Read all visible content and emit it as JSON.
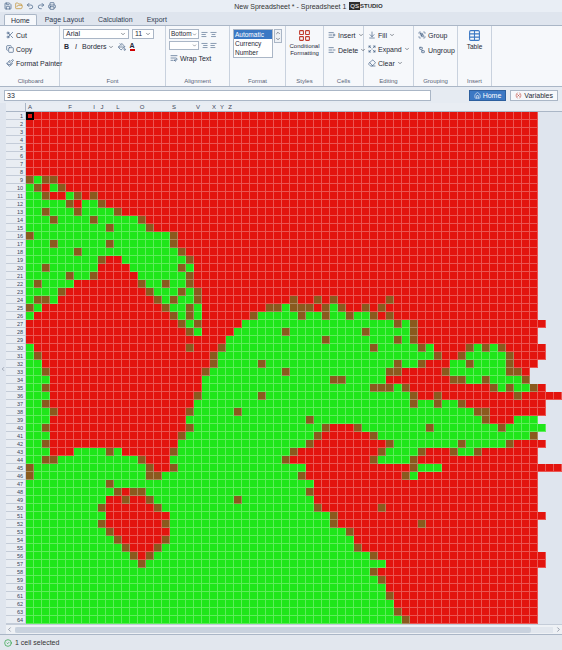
{
  "window": {
    "title": "New Spreadsheet * - Spreadsheet 1",
    "logo": {
      "mark": "QS",
      "text": "STUDIO"
    }
  },
  "tabs": [
    {
      "label": "Home",
      "selected": true
    },
    {
      "label": "Page Layout",
      "selected": false
    },
    {
      "label": "Calculation",
      "selected": false
    },
    {
      "label": "Export",
      "selected": false
    }
  ],
  "ribbon": {
    "clipboard": {
      "label": "Clipboard",
      "cut": "Cut",
      "copy": "Copy",
      "format_painter": "Format Painter"
    },
    "font": {
      "label": "Font",
      "family": "Arial",
      "size": "11",
      "bold": "B",
      "italic": "I",
      "borders": "Borders",
      "color_letter": "A"
    },
    "alignment": {
      "label": "Alignment",
      "vertical": "Bottom",
      "wrap": "Wrap Text"
    },
    "format": {
      "label": "Format",
      "options": [
        {
          "label": "Automatic",
          "selected": true
        },
        {
          "label": "Currency",
          "selected": false
        },
        {
          "label": "Number",
          "selected": false
        }
      ]
    },
    "styles": {
      "label": "Styles",
      "button": "Conditional Formatting"
    },
    "cells": {
      "label": "Cells",
      "buttons": [
        "Insert",
        "Delete"
      ]
    },
    "editing": {
      "label": "Editing",
      "buttons": [
        "Fill",
        "Expand",
        "Clear"
      ]
    },
    "grouping": {
      "label": "Grouping",
      "buttons": [
        "Group",
        "Ungroup"
      ]
    },
    "insert": {
      "label": "Insert",
      "button": "Table"
    }
  },
  "formula_bar": {
    "name_box": "33",
    "views": [
      {
        "label": "Home",
        "selected": true
      },
      {
        "label": "Variables",
        "selected": false
      }
    ]
  },
  "sheet": {
    "palette": {
      "r": "#e3140e",
      "g": "#1fe61a",
      "d": "#8a5a1e"
    },
    "selection": {
      "row": "1",
      "column": "A"
    },
    "column_labels": [
      "A",
      "",
      "",
      "",
      "",
      "F",
      "",
      "",
      "I",
      "J",
      "",
      "L",
      "",
      "",
      "O",
      "",
      "",
      "",
      "S",
      "",
      "",
      "V",
      "",
      "X",
      "Y",
      "Z",
      "",
      "",
      "",
      "",
      "",
      "",
      "",
      "",
      "",
      "",
      "",
      "",
      "",
      "",
      "",
      "",
      "",
      "",
      "",
      "",
      "",
      "",
      "",
      "",
      "",
      "",
      "",
      "",
      "",
      "",
      "",
      "",
      "",
      "",
      "",
      "",
      "",
      ""
    ],
    "rows": [
      {
        "label": "1",
        "cells": "rrrrrrrrrrrrrrrrrrrrrrrrrrrrrrrrrrrrrrrrrrrrrrrrrrrrrrrrrrrrrrrr"
      },
      {
        "label": "2",
        "cells": "rrrrrrrrrrrrrrrrrrrrrrrrrrrrrrrrrrrrrrrrrrrrrrrrrrrrrrrrrrrrrrrr"
      },
      {
        "label": "3",
        "cells": "rrrrrrrrrrrrrrrrrrrrrrrrrrrrrrrrrrrrrrrrrrrrrrrrrrrrrrrrrrrrrrrr"
      },
      {
        "label": "4",
        "cells": "rrrrrrrrrrrrrrrrrrrrrrrrrrrrrrrrrrrrrrrrrrrrrrrrrrrrrrrrrrrrrrrr"
      },
      {
        "label": "5",
        "cells": "rrrrrrrrrrrrrrrrrrrrrrrrrrrrrrrrrrrrrrrrrrrrrrrrrrrrrrrrrrrrrrrr"
      },
      {
        "label": "6",
        "cells": "rrrrrrrrrrrrrrrrrrrrrrrrrrrrrrrrrrrrrrrrrrrrrrrrrrrrrrrrrrrrrrrr"
      },
      {
        "label": "7",
        "cells": "rrrrrrrrrrrrrrrrrrrrrrrrrrrrrrrrrrrrrrrrrrrrrrrrrrrrrrrrrrrrrrrr"
      },
      {
        "label": "8",
        "cells": "rrrrrrrrrrrrrrrrrrrrrrrrrrrrrrrrrrrrrrrrrrrrrrrrrrrrrrrrrrrrrrrr"
      },
      {
        "label": "9",
        "cells": "dgddrrrrrrrrrrrrrrrrrrrrrrrrrrrrrrrrrrrrrrrrrrrrrrrrrrrrrrrrrrrr"
      },
      {
        "label": "10",
        "cells": "gdrgdrrrrrrrrrrrrrrrrrrrrrrrrrrrrrrrrrrrrrrrrrrrrrrrrrrrrrrrrrrr"
      },
      {
        "label": "11",
        "cells": "ggdrrgdrdrrrrrrrrrrrrrrrrrrrrrrrrrrrrrrrrrrrrrrrrrrrrrrrrrrrrrrr"
      },
      {
        "label": "12",
        "cells": "gggggdrggdrrrrrrrrrrrrrrrrrrrrrrrrrrrrrrrrrrrrrrrrrrrrrrrrrrrrrr"
      },
      {
        "label": "13",
        "cells": "ggdgggdggggdrrrrrrrrrrrrrrrrrrrrrrrrrrrrrrrrrrrrrrrrrrrrrrrrrrrr"
      },
      {
        "label": "14",
        "cells": "gggdggggdgggggdrrrrrrrrrrrrrrrrrrrrrrrrrrrrrrrrrrrrrrrrrrrrrrrrr"
      },
      {
        "label": "15",
        "cells": "ggggggggggdggggdrrrrrrrrrrrrrrrrrrrrrrrrrrrrrrrrrrrrrrrrrrrrrrrr"
      },
      {
        "label": "16",
        "cells": "dgggggggggggggggggdrrrrrrrrrrrrrrrrrrrrrrrrrrrrrrrrrrrrrrrrrrrrr"
      },
      {
        "label": "17",
        "cells": "gggdggggggdgggggggdrrrrrrrrrrrrrrrrrrrrrrrrrrrrrrrrrrrrrrrrrrrrr"
      },
      {
        "label": "18",
        "cells": "ggggggdggggggggggggdrrrrrrrrrrrrrrrrrrrrrrrrrrrrrrrrrrrrrrrrrrrr"
      },
      {
        "label": "19",
        "cells": "gggggggggdrrggggggggdrrrrrrrrrrrrrrrrrrrrrrrrrrrrrrrrrrrrrrrrrrr"
      },
      {
        "label": "20",
        "cells": "ggdggggggrrrrggggggdgrrrrrrrrrrrrrrrrrrrrrrrrrrrrrrrrrrrrrrrrrrr"
      },
      {
        "label": "21",
        "cells": "gggggdggdrrrrrggggggdrrrrrrrrrrrrrrrrrrrrrrrrrrrrrrrrrrrrrrrrrrr"
      },
      {
        "label": "22",
        "cells": "gdggggrrrrrrrrdggdggdrrrrrrrrrrrrrrrrrrrrrrrrrrrrrrrrrrrrrrrrrrr"
      },
      {
        "label": "23",
        "cells": "ggggdrrrrrrrrrrdgggdgdrrrrrrrrrrrrrrrrrrrrrrrrrrrrrrrrrrrrrrrrrr"
      },
      {
        "label": "24",
        "cells": "gddgrrrrrrrrrrrrdgdggdrrrrrrrrrrrdrrdrdrrrrrrdrrrrrrrrrrrrrrrrrr"
      },
      {
        "label": "25",
        "cells": "dgrrrrrrrrrrrrrrrdggdgrrrrrrrrddgdddrdgdrrdrdrrrrrrrrrrrrrrrrrrr"
      },
      {
        "label": "26",
        "cells": "grrrrrrrrrrrrrrrrrdgdgrrrrrrdgggggdggdggdggdrdrrrrrrrrrrrrrrrrrr"
      },
      {
        "label": "27",
        "cells": "rrrrrrrrrrrrrrrrrrrdgdrrrrrgggggggggggggggggggdgdrrrrrrrrrrrrrrrr"
      },
      {
        "label": "28",
        "cells": "rrrrrrrrrrrrrrrrrrrrdgrrrrggggggdgggggggggdgggggdrrrrrrrrrrrrrrr"
      },
      {
        "label": "29",
        "cells": "rrrrrrrrrrrrrrrrrrrrrrrrrggggggggggggdggggggggdgdrrrrrrrrrrrrrrr"
      },
      {
        "label": "30",
        "cells": "grrrrrrrrrrrrrrrrrrrdrrrdggggggggggggggggggdgggggdgrrrrdgdgdrrrrr"
      },
      {
        "label": "31",
        "cells": "gdrrrrrrrrrrrrrrrrrrrrrdgggggggggggggggggggggggggggdrrdgggggdrrrr"
      },
      {
        "label": "32",
        "cells": "ggrrrrrrrrrrrrrrrrrrrrrdgggggdggggggggggggggggdggdrrrggdggggdrrr"
      },
      {
        "label": "33",
        "cells": "ggdrrrrrrrrrrrrrrrrrrrdgggggggggdggggggggggggddrrrrrdgggggggddr"
      },
      {
        "label": "34",
        "cells": "gggrrrrrrrrrrrrrrrrrrrggggggggggggggggddgggggrrrrrrrrddggdggggd"
      },
      {
        "label": "35",
        "cells": "ggdrrrrrrrrrrrrrrrrrrrgggggggggggggggggggggdddgdrrrrrrrrrrdgdggdr"
      },
      {
        "label": "36",
        "cells": "gggrrrrrrrrrrrrrrrrrrdgggggggdggggggggggggggggggdrrdrrrrrrrrrdrrrrr"
      },
      {
        "label": "37",
        "cells": "ggdrrrrrrrrrrrrrrrrrrgggggggggggggggggggggggggggdggdggdrrrrrrrrrr"
      },
      {
        "label": "38",
        "cells": "gggdrrrrrrrrrrrrrrrrdgggggdgggggggggggggggggggggggggggggddrrrrrrr"
      },
      {
        "label": "39",
        "cells": "gggrrrrrrrrrrrrrrrrrgggggggggggggggdgggggggggggggggggggggdrrrggg"
      },
      {
        "label": "40",
        "cells": "ggdrrrrrrrrrrrrrrrrrdggggggggggggggggdrrrdggggggggdggggggggdggggg"
      },
      {
        "label": "41",
        "cells": "gggrrrrrrrrrrrrrrrrdggggggggggggggggdrrrrrrdgggggggggggggggggggd"
      },
      {
        "label": "42",
        "cells": "ggdrrrrrrrrrrrrrrrrggggggggggggggggdrrrrrrrrrdggggggggdgggggdrrrr"
      },
      {
        "label": "43",
        "cells": "gggrrrggggdgrrrrrrdggggggggggggggdrrrrrrrrrrdggggdrrrdggdrrrrrrr"
      },
      {
        "label": "44",
        "cells": "ggddggggggggggdrrrggggggggggggggdrrrrrrrrrrdggggdrrrrrrrrrrrrrrr"
      },
      {
        "label": "45",
        "cells": "dggggggggggggggdrrdggggggggggggggggrrrrrrrrrrrrrdgggrrrrrrrrrrrrrrr"
      },
      {
        "label": "46",
        "cells": "dggggggggggggggddgggggggggggggggggdrrrrrrrrrrrrdgrrrrrrrrrrrrrrr"
      },
      {
        "label": "47",
        "cells": "ggggggggggdgggggggggggggggggggggggggrrrrrrrrrrrrrrrrrrrrrrrrrrrr"
      },
      {
        "label": "48",
        "cells": "gggggggggggdrddggggggggggggggggggggdrrrrrrrrrrrrrrrrrrrrrrrrrrrr"
      },
      {
        "label": "49",
        "cells": "ggggggggggrrdrrdggggggggggdgggggggggrrrrrrrrrrrrrrrrrrrrrrrrrrrr"
      },
      {
        "label": "50",
        "cells": "gggggggggdrrrrrrdgggggggggggggggggggdrrrrrrrdrrrrrrrrrrrrrrrrrrr"
      },
      {
        "label": "51",
        "cells": "ggggggggggrrrrrrrrggggggggggggggggggggdrrrrrrrrrrrrrrrrrrrrrrrrrr"
      },
      {
        "label": "52",
        "cells": "gggggggggdrrrrrrrdggggggggggggggggggggdrrrrrrrrrrdrrrrrrrrrrrrrr"
      },
      {
        "label": "53",
        "cells": "ggggggggggdrrrrrrrggggggggggggggggggggggdrrrrrrrrrrrrrrrrrrrrrrr"
      },
      {
        "label": "54",
        "cells": "gggggggggggdrrrrrdgggggggggggggggggggggggrrrrrrrrrrrrrrrrrrrrrrr"
      },
      {
        "label": "55",
        "cells": "ggggggggggggdrrrdggggggggggggggggggggggggdrrrrrrrrrrrrrrrrrrrrrr"
      },
      {
        "label": "56",
        "cells": "gggggggggggggdrdgggggggggggggggggggggggggggdrrrrrrrrrrrrrrrrrrrrr"
      },
      {
        "label": "57",
        "cells": "ggggggggggggggdggggggggggggggggggggggggggggggrrrrrrrrrrrrrrrrrrrr"
      },
      {
        "label": "58",
        "cells": "gggggggggggggggggggggggggggggggggggggggggggdrrrrrrrrrrrrrrrrrrrr"
      },
      {
        "label": "59",
        "cells": "ggggggggggggggggggggggggggggggggggggggggggggdrrrrrrrrrrrrrrrrrrr"
      },
      {
        "label": "60",
        "cells": "gggggggggggggggggggggggggggggggggggggggggggggrrrrrrrrrrrrrrrrrrr"
      },
      {
        "label": "61",
        "cells": "gggggggggggggggggggggggggggggggggggggggggggggdrrrrrrrrrrrrrrrrrr"
      },
      {
        "label": "62",
        "cells": "ggggggggggggggggggggggggggggggggggggggggggggggrrrrrrrrrrrrrrrrrr"
      },
      {
        "label": "63",
        "cells": "ggggggggggggggggggggggggggggggggggggggggggggggdrrrrrrrrrrrrrrrrr"
      },
      {
        "label": "64",
        "cells": "gggggggggggggggggggggggggggggggggggggggggggggggdrrrrrrrrrrrrrrrr"
      }
    ]
  },
  "status_bar": {
    "text": "1 cell selected"
  }
}
